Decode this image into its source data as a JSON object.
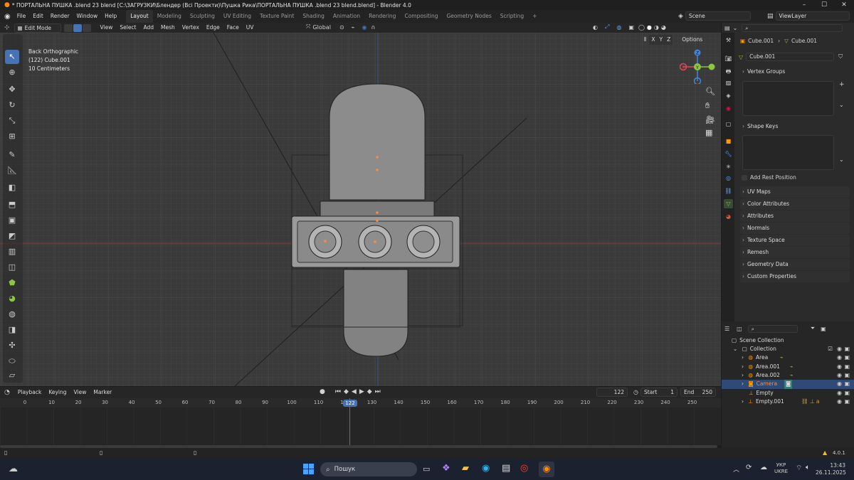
{
  "window": {
    "title": "* ПОРТАЛЬНА ПУШКА .blend 23 blend [C:\\ЗАГРУЗКИ\\Блендер (Всі Проекти)\\Пушка Рика\\ПОРТАЛЬНА ПУШКА .blend 23 blend.blend] - Blender 4.0",
    "minimize": "–",
    "maximize": "☐",
    "close": "✕"
  },
  "menubar": {
    "items": [
      "File",
      "Edit",
      "Render",
      "Window",
      "Help"
    ],
    "workspaces": [
      "Layout",
      "Modeling",
      "Sculpting",
      "UV Editing",
      "Texture Paint",
      "Shading",
      "Animation",
      "Rendering",
      "Compositing",
      "Geometry Nodes",
      "Scripting"
    ],
    "active_workspace": "Layout",
    "add_tab": "+",
    "scene": "Scene",
    "view_layer": "ViewLayer"
  },
  "viewport_header": {
    "mode": "Edit Mode",
    "menus": [
      "View",
      "Select",
      "Add",
      "Mesh",
      "Vertex",
      "Edge",
      "Face",
      "UV"
    ],
    "orientation": "Global",
    "options": "Options",
    "axes": [
      "X",
      "Y",
      "Z"
    ]
  },
  "viewport": {
    "view_name": "Back Orthographic",
    "object_info": "(122) Cube.001",
    "scale_info": "10 Centimeters",
    "gizmo": {
      "x": "X",
      "y": "Y",
      "z": "Z"
    }
  },
  "properties": {
    "breadcrumb_object": "Cube.001",
    "breadcrumb_mesh": "Cube.001",
    "mesh_name": "Cube.001",
    "vertex_groups": "Vertex Groups",
    "shape_keys": "Shape Keys",
    "add_rest_position": "Add Rest Position",
    "collapsed_panels": [
      "UV Maps",
      "Color Attributes",
      "Attributes",
      "Normals",
      "Texture Space",
      "Remesh",
      "Geometry Data",
      "Custom Properties"
    ]
  },
  "outliner": {
    "scene_collection": "Scene Collection",
    "collection": "Collection",
    "items": [
      {
        "name": "Area",
        "selected": false
      },
      {
        "name": "Area.001",
        "selected": false
      },
      {
        "name": "Area.002",
        "selected": false
      },
      {
        "name": "Camera",
        "selected": true
      },
      {
        "name": "Empty",
        "selected": false
      },
      {
        "name": "Empty.001",
        "selected": false
      }
    ]
  },
  "timeline": {
    "menus": [
      "Playback",
      "Keying",
      "View",
      "Marker"
    ],
    "current_frame": "122",
    "start_label": "Start",
    "start": "1",
    "end_label": "End",
    "end": "250",
    "ticks": [
      "0",
      "10",
      "20",
      "30",
      "40",
      "50",
      "60",
      "70",
      "80",
      "90",
      "100",
      "110",
      "120",
      "130",
      "140",
      "150",
      "160",
      "170",
      "180",
      "190",
      "200",
      "210",
      "220",
      "230",
      "240",
      "250"
    ]
  },
  "statusbar": {
    "version": "4.0.1"
  },
  "taskbar": {
    "search_placeholder": "Пошук",
    "language_line1": "УКР",
    "language_line2": "UKRE",
    "time": "13:43",
    "date": "26.11.2025"
  },
  "colors": {
    "accent": "#4772b3",
    "x_axis": "#e04855",
    "y_axis": "#8cc63f",
    "z_axis": "#3f86e0",
    "selected_text": "#ff8c3a"
  }
}
